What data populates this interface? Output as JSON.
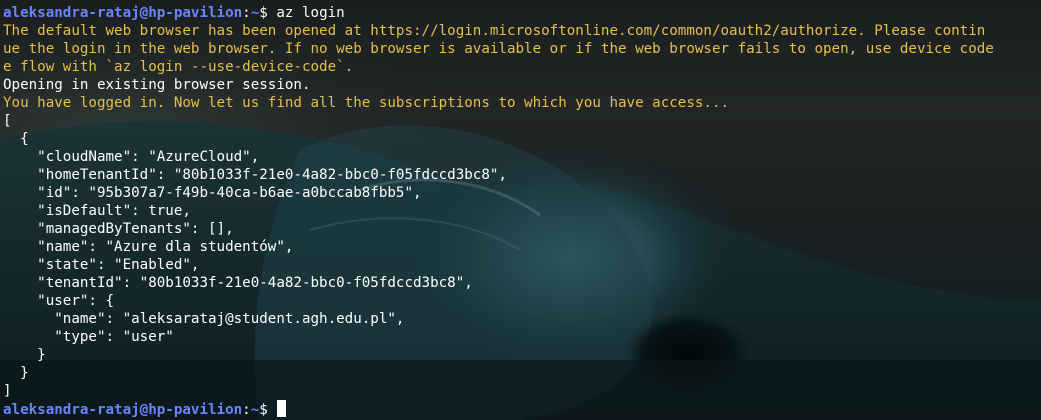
{
  "prompt": {
    "user_host": "aleksandra-rataj@hp-pavilion",
    "colon": ":",
    "path": "~",
    "symbol": "$ "
  },
  "command": "az login",
  "output_warning": [
    "The default web browser has been opened at https://login.microsoftonline.com/common/oauth2/authorize. Please contin",
    "ue the login in the web browser. If no web browser is available or if the web browser fails to open, use device code",
    "e flow with `az login --use-device-code`."
  ],
  "output_info": "Opening in existing browser session.",
  "output_logged_in": "You have logged in. Now let us find all the subscriptions to which you have access...",
  "json_lines": [
    "[",
    "  {",
    "    \"cloudName\": \"AzureCloud\",",
    "    \"homeTenantId\": \"80b1033f-21e0-4a82-bbc0-f05fdccd3bc8\",",
    "    \"id\": \"95b307a7-f49b-40ca-b6ae-a0bccab8fbb5\",",
    "    \"isDefault\": true,",
    "    \"managedByTenants\": [],",
    "    \"name\": \"Azure dla studentów\",",
    "    \"state\": \"Enabled\",",
    "    \"tenantId\": \"80b1033f-21e0-4a82-bbc0-f05fdccd3bc8\",",
    "    \"user\": {",
    "      \"name\": \"aleksarataj@student.agh.edu.pl\",",
    "      \"type\": \"user\"",
    "    }",
    "  }",
    "]"
  ],
  "colors": {
    "prompt_user": "#6b84ff",
    "warning_text": "#e3c04a",
    "default_text": "#ffffff"
  },
  "background_image": "ocean-wave-wallpaper"
}
